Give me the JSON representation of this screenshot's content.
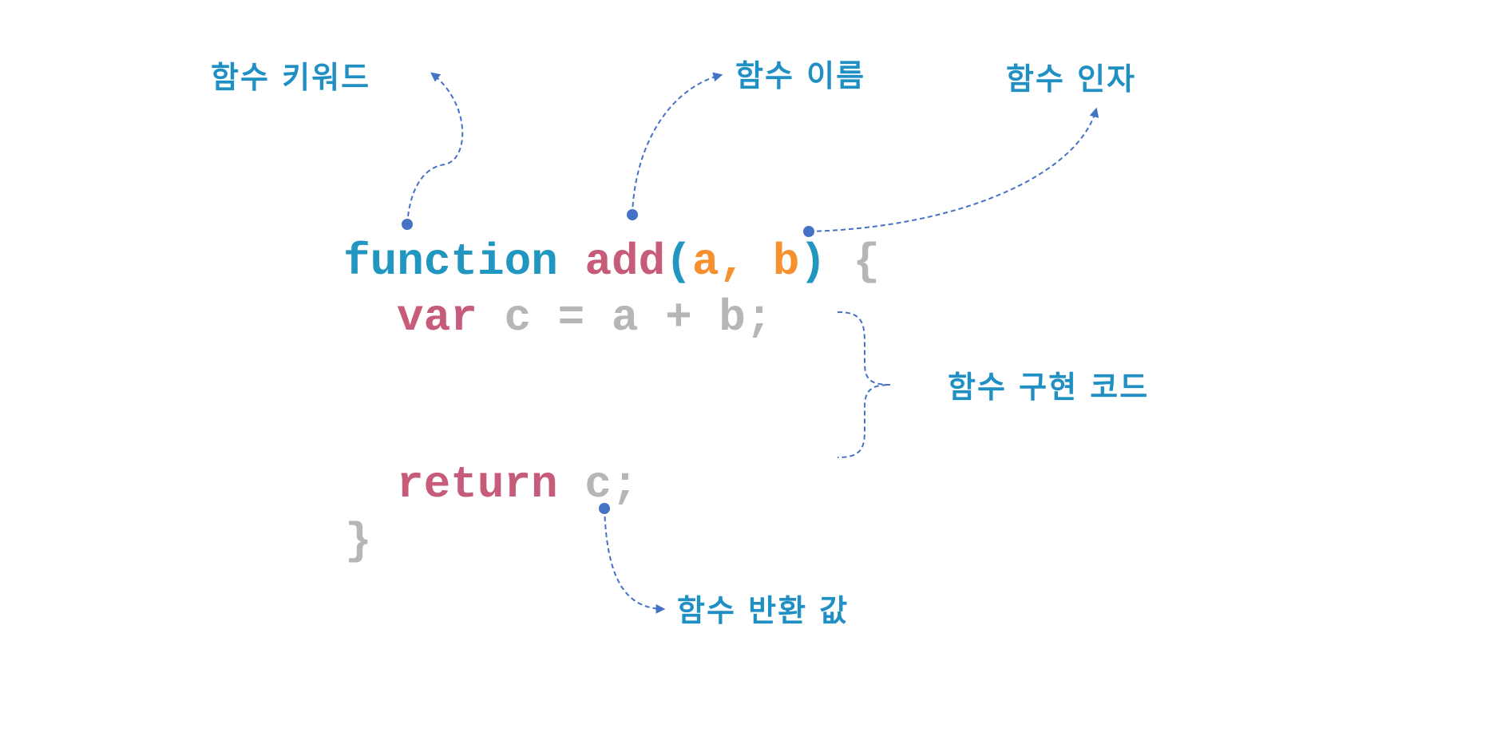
{
  "code": {
    "line1": {
      "keyword": "function",
      "name": "add",
      "open_paren": "(",
      "arg1": "a",
      "comma": ", ",
      "arg2": "b",
      "close_paren": ")",
      "brace": "{"
    },
    "line2": {
      "keyword": "var",
      "rest": "c = a + b;"
    },
    "line3": {
      "keyword": "return",
      "rest": "c;"
    },
    "line4": {
      "brace": "}"
    }
  },
  "labels": {
    "keyword": "함수 키워드",
    "name": "함수 이름",
    "params": "함수 인자",
    "body": "함수 구현 코드",
    "return": "함수 반환 값"
  },
  "colors": {
    "keyword": "#2196c0",
    "name": "#c75b7a",
    "argument": "#f7902e",
    "plain": "#b7b5b7",
    "label": "#1f8fc4",
    "annotation": "#4472c4"
  }
}
